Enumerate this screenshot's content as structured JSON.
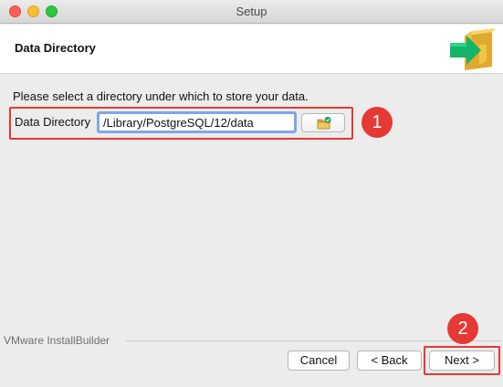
{
  "window": {
    "title": "Setup"
  },
  "header": {
    "title": "Data Directory"
  },
  "instruction": "Please select a directory under which to store your data.",
  "field": {
    "label": "Data Directory",
    "value": "/Library/PostgreSQL/12/data"
  },
  "annotations": {
    "step1": "1",
    "step2": "2"
  },
  "footer": {
    "vendor": "VMware InstallBuilder"
  },
  "buttons": {
    "cancel": "Cancel",
    "back": "< Back",
    "next": "Next >"
  },
  "icons": {
    "logo": "installer-box-arrow-icon",
    "browse": "folder-browse-icon"
  },
  "colors": {
    "annotation": "#e53935",
    "focus": "#7ea6e8",
    "arrow": "#14b56a",
    "box": "#f4c542"
  }
}
